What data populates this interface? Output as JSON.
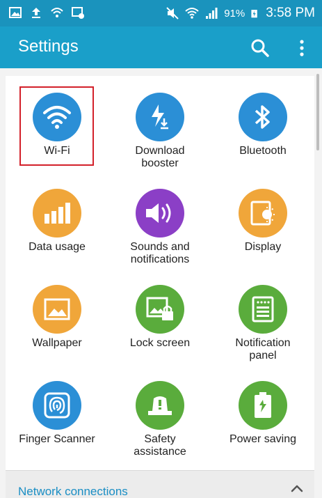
{
  "status_bar": {
    "battery": "91%",
    "time": "3:58 PM",
    "left_icons": [
      "picture-icon",
      "upload-icon",
      "wifi-icon",
      "photo-notification-icon"
    ],
    "right_icons": [
      "mute-icon",
      "wifi-icon",
      "signal-icon",
      "battery-charging-icon"
    ]
  },
  "app_bar": {
    "title": "Settings",
    "icons": [
      "search-icon",
      "more-vert-icon"
    ]
  },
  "tiles": [
    {
      "label": "Wi-Fi",
      "icon": "wifi-icon",
      "color": "#2b8fd6",
      "highlighted": true
    },
    {
      "label": "Download\nbooster",
      "icon": "download-booster-icon",
      "color": "#2b8fd6"
    },
    {
      "label": "Bluetooth",
      "icon": "bluetooth-icon",
      "color": "#2b8fd6"
    },
    {
      "label": "Data usage",
      "icon": "data-usage-icon",
      "color": "#f0a63a"
    },
    {
      "label": "Sounds and\nnotifications",
      "icon": "speaker-icon",
      "color": "#8b3fc6"
    },
    {
      "label": "Display",
      "icon": "display-icon",
      "color": "#f0a63a"
    },
    {
      "label": "Wallpaper",
      "icon": "wallpaper-icon",
      "color": "#f0a63a"
    },
    {
      "label": "Lock screen",
      "icon": "lock-screen-icon",
      "color": "#5aac3c"
    },
    {
      "label": "Notification\npanel",
      "icon": "notification-panel-icon",
      "color": "#5aac3c"
    },
    {
      "label": "Finger Scanner",
      "icon": "fingerprint-icon",
      "color": "#2b8fd6"
    },
    {
      "label": "Safety\nassistance",
      "icon": "safety-icon",
      "color": "#5aac3c"
    },
    {
      "label": "Power saving",
      "icon": "power-saving-icon",
      "color": "#5aac3c"
    }
  ],
  "section": {
    "title": "Network connections",
    "icon": "chevron-up-icon"
  },
  "colors": {
    "status_bar": "#1a93bd",
    "app_bar": "#1a9fc9",
    "highlight": "#d3202a",
    "section_title": "#1a8ec4"
  }
}
